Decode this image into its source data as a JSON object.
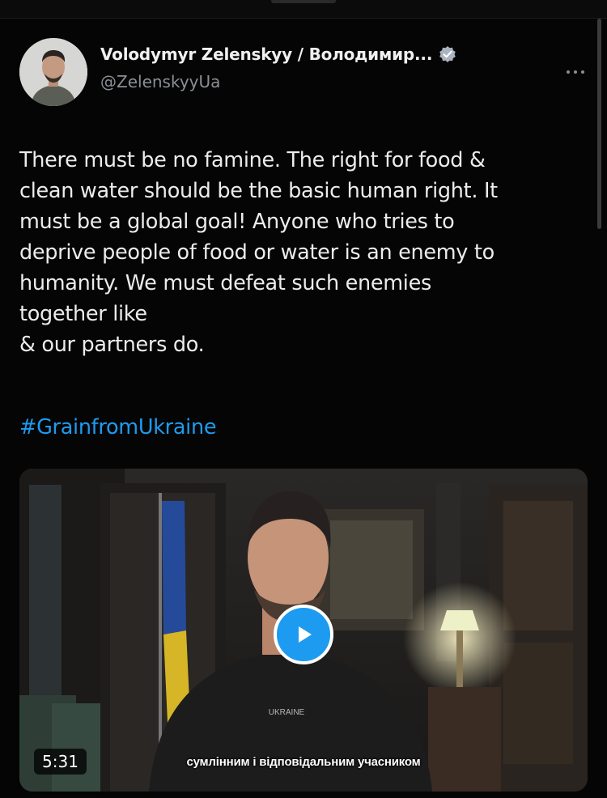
{
  "tweet": {
    "author_name": "Volodymyr Zelenskyy / Володимир...",
    "handle": "@ZelenskyyUa",
    "text_lines": [
      "There must be no famine. The right for food &",
      "clean water should be the basic human right. It",
      "must be a global goal! Anyone who tries to",
      "deprive people of food or water is an enemy to",
      "humanity. We must defeat such enemies"
    ],
    "last_line_before_flag": "together like",
    "last_line_after_flag": "& our partners do.",
    "hashtag": "#GrainfromUkraine"
  },
  "video": {
    "duration": "5:31",
    "subtitle": "сумлінним і відповідальним учасником",
    "shirt_text": "UKRAINE"
  },
  "icons": {
    "verified": "verified-badge-icon",
    "more": "more-options-icon",
    "play": "play-icon",
    "flag": "ukraine-flag-icon"
  },
  "colors": {
    "background": "#000000",
    "link": "#1d9bf0",
    "secondary_text": "#8b8f94",
    "flag_blue": "#2a6fd6",
    "flag_yellow": "#f5d000"
  }
}
